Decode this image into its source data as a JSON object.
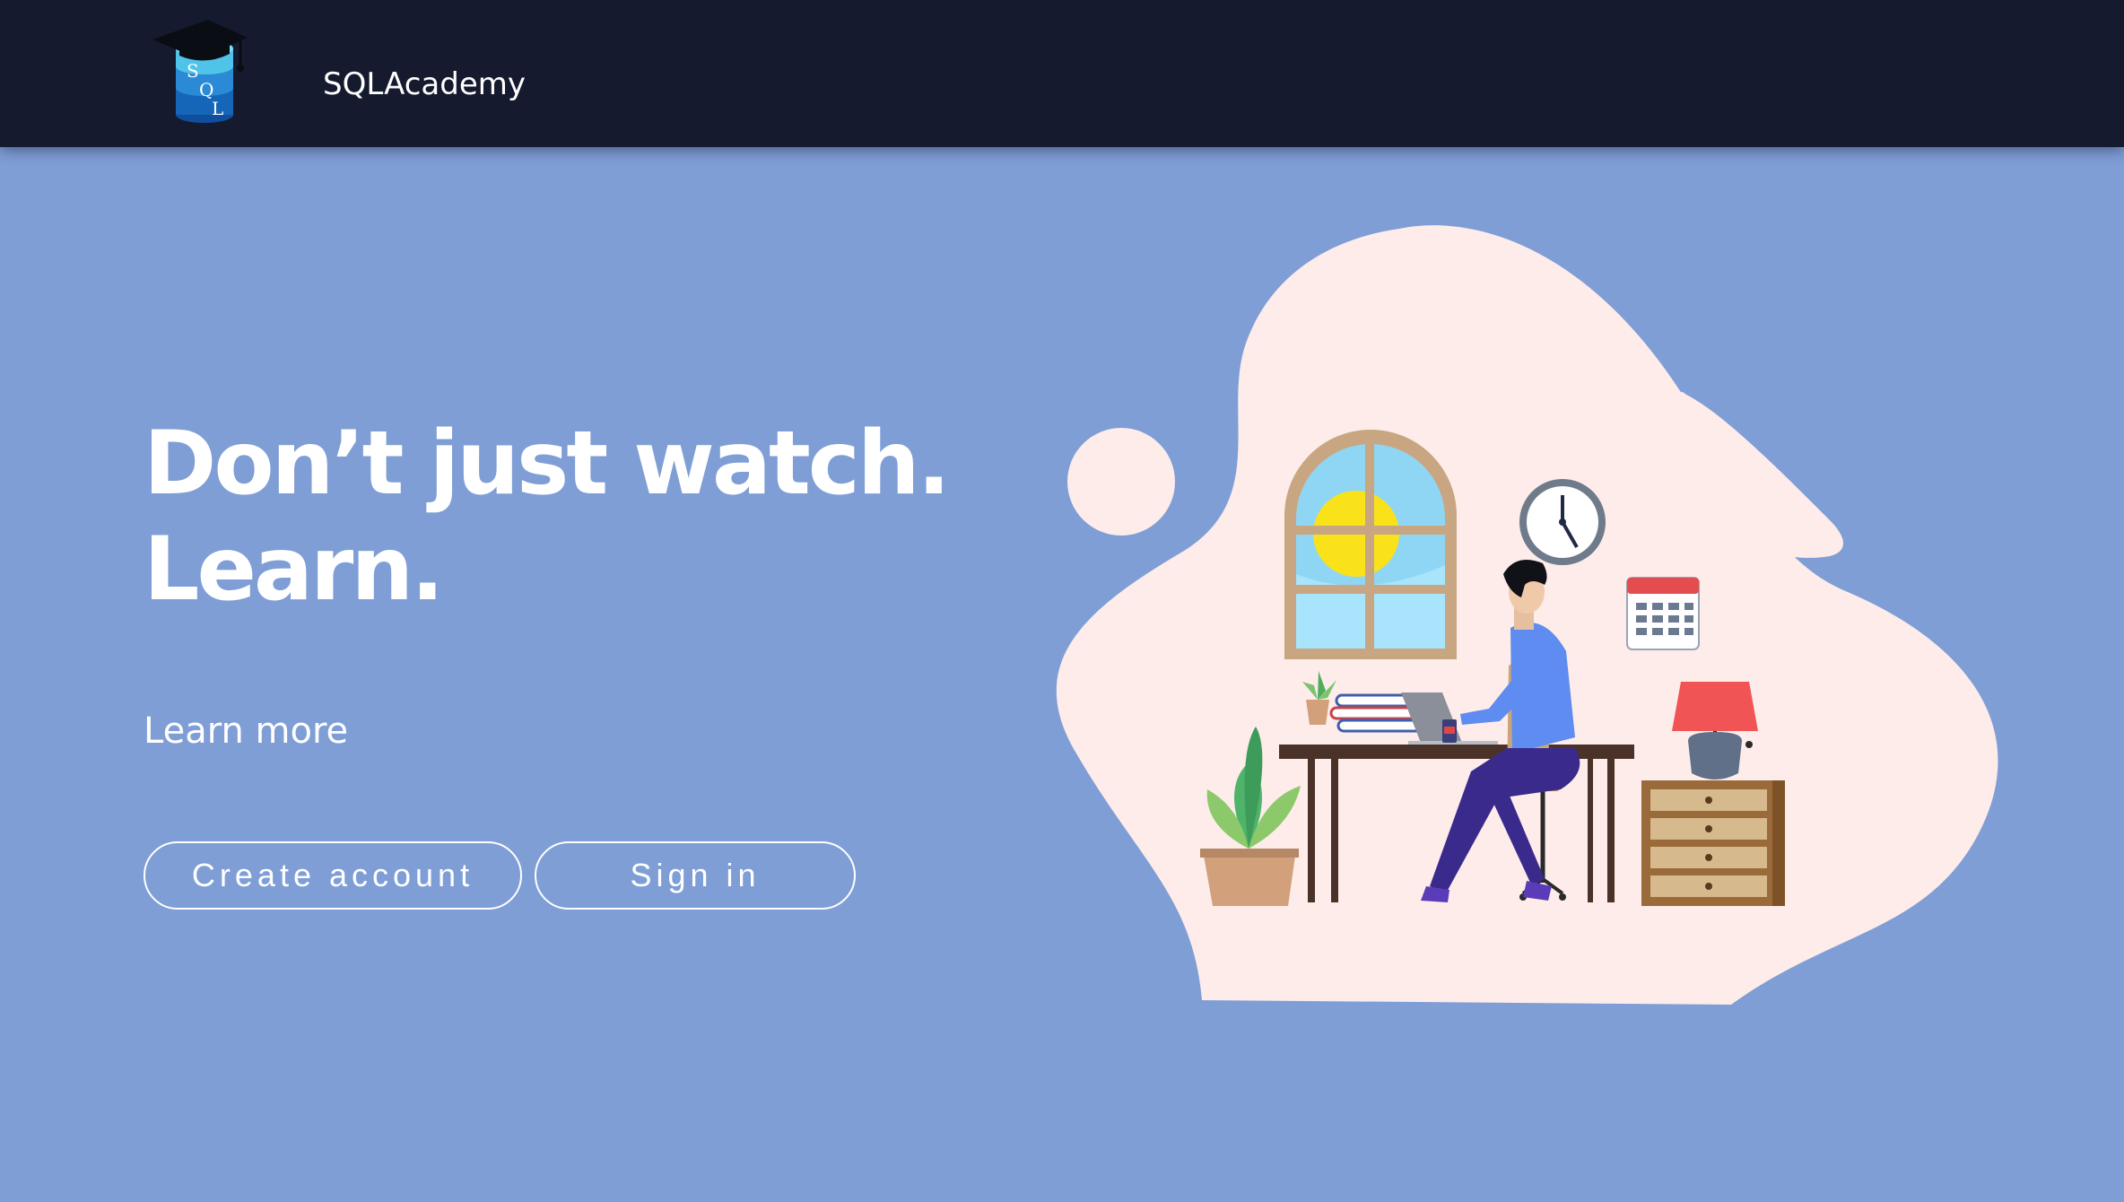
{
  "app": {
    "brand_name": "SQLAcademy",
    "logo_letters": [
      "S",
      "Q",
      "L"
    ]
  },
  "hero": {
    "title_line1": "Don’t just watch.",
    "title_line2": "Learn.",
    "learn_more": "Learn more"
  },
  "actions": {
    "create_account": "Create account",
    "sign_in": "Sign in"
  },
  "illustration": {
    "subject": "person-working-at-desk"
  },
  "colors": {
    "background": "#7f9ed6",
    "topbar": "#161a2e",
    "blob": "#fdecea",
    "text": "#ffffff"
  }
}
